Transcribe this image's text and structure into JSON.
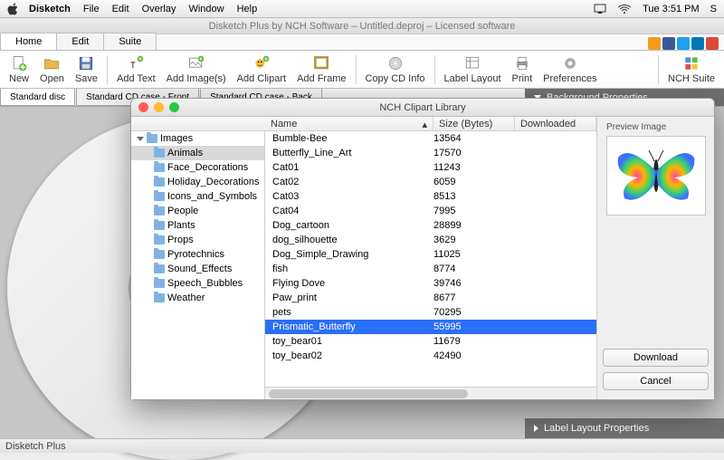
{
  "menubar": {
    "app": "Disketch",
    "items": [
      "File",
      "Edit",
      "Overlay",
      "Window",
      "Help"
    ],
    "clock": "Tue 3:51 PM",
    "rightUser": "S"
  },
  "window": {
    "title": "Disketch Plus by NCH Software – Untitled.deproj – Licensed software"
  },
  "mainTabs": [
    "Home",
    "Edit",
    "Suite"
  ],
  "toolbar": {
    "new": "New",
    "open": "Open",
    "save": "Save",
    "addText": "Add Text",
    "addImages": "Add Image(s)",
    "addClipart": "Add Clipart",
    "addFrame": "Add Frame",
    "copyCD": "Copy CD Info",
    "labelLayout": "Label Layout",
    "print": "Print",
    "prefs": "Preferences",
    "suite": "NCH Suite"
  },
  "docTabs": [
    "Standard disc",
    "Standard CD case - Front",
    "Standard CD case - Back"
  ],
  "bgPanel": {
    "title": "Background Properties"
  },
  "labelPanel": {
    "title": "Label Layout Properties"
  },
  "status": {
    "app": "Disketch Plus"
  },
  "dialog": {
    "title": "NCH Clipart Library",
    "tree": {
      "root": "Images",
      "items": [
        "Animals",
        "Face_Decorations",
        "Holiday_Decorations",
        "Icons_and_Symbols",
        "People",
        "Plants",
        "Props",
        "Pyrotechnics",
        "Sound_Effects",
        "Speech_Bubbles",
        "Weather"
      ],
      "selected": "Animals"
    },
    "columns": {
      "name": "Name",
      "size": "Size (Bytes)",
      "downloaded": "Downloaded"
    },
    "rows": [
      {
        "name": "Bumble-Bee",
        "size": "13564"
      },
      {
        "name": "Butterfly_Line_Art",
        "size": "17570"
      },
      {
        "name": "Cat01",
        "size": "11243"
      },
      {
        "name": "Cat02",
        "size": "6059"
      },
      {
        "name": "Cat03",
        "size": "8513"
      },
      {
        "name": "Cat04",
        "size": "7995"
      },
      {
        "name": "Dog_cartoon",
        "size": "28899"
      },
      {
        "name": "dog_silhouette",
        "size": "3629"
      },
      {
        "name": "Dog_Simple_Drawing",
        "size": "11025"
      },
      {
        "name": "fish",
        "size": "8774"
      },
      {
        "name": "Flying Dove",
        "size": "39746"
      },
      {
        "name": "Paw_print",
        "size": "8677"
      },
      {
        "name": "pets",
        "size": "70295"
      },
      {
        "name": "Prismatic_Butterfly",
        "size": "55995"
      },
      {
        "name": "toy_bear01",
        "size": "11679"
      },
      {
        "name": "toy_bear02",
        "size": "42490"
      }
    ],
    "selectedRow": "Prismatic_Butterfly",
    "preview": {
      "label": "Preview Image"
    },
    "buttons": {
      "download": "Download",
      "cancel": "Cancel"
    }
  }
}
